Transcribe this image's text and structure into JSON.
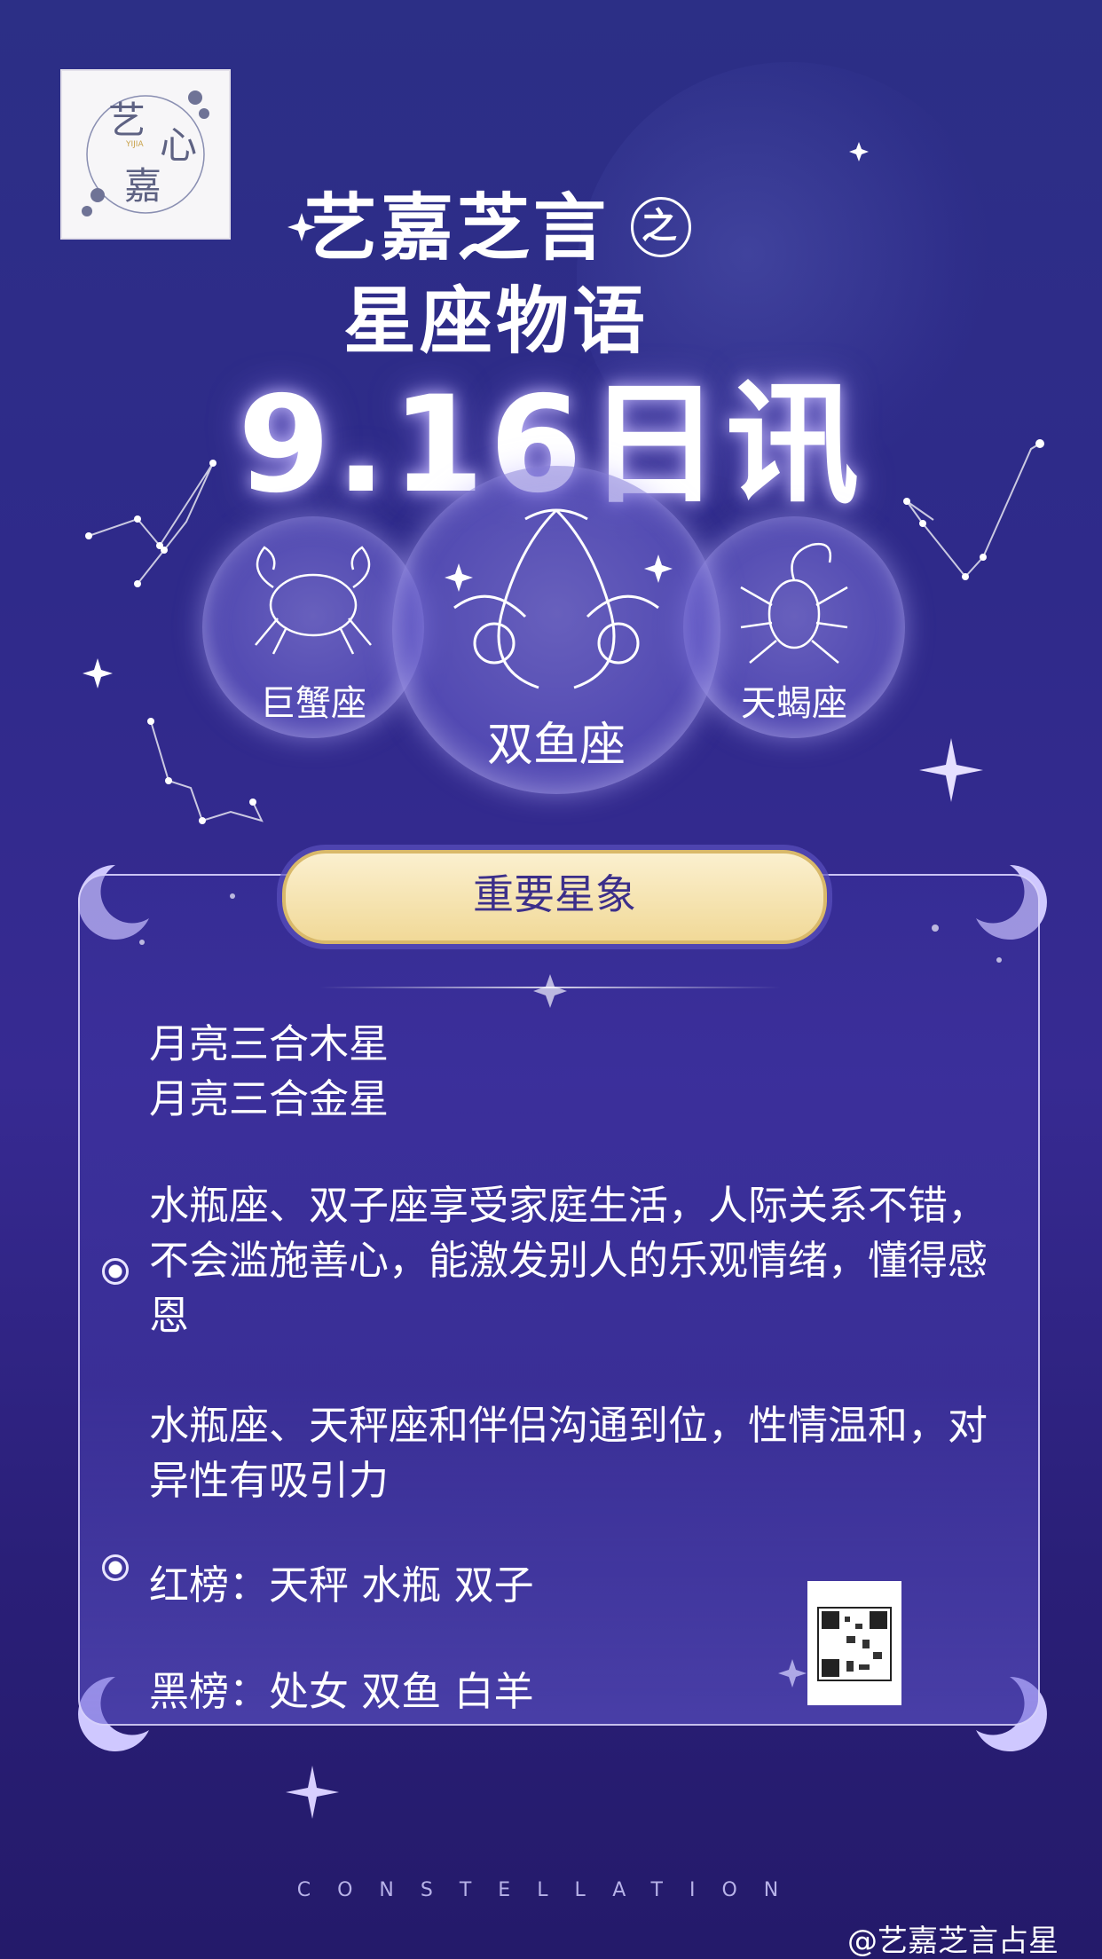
{
  "logo": {
    "chars": [
      "艺",
      "心",
      "嘉"
    ],
    "sub": "YIJIA"
  },
  "header": {
    "line1": "艺嘉芝言",
    "zhi": "之",
    "line2": "星座物语",
    "date": "9.16日讯"
  },
  "signs": {
    "left": "巨蟹座",
    "center": "双鱼座",
    "right": "天蝎座"
  },
  "panel": {
    "title": "重要星象",
    "aspects": [
      "月亮三合木星",
      "月亮三合金星"
    ],
    "para1": "水瓶座、双子座享受家庭生活，人际关系不错，不会滥施善心，能激发别人的乐观情绪，懂得感恩",
    "para2": "水瓶座、天秤座和伴侣沟通到位，性情温和，对异性有吸引力",
    "red": "红榜：天秤 水瓶 双子",
    "black": "黑榜：处女 双鱼 白羊"
  },
  "footer": {
    "word": "CONSTELLATION",
    "watermark": "@艺嘉芝言占星"
  },
  "colors": {
    "bg": "#2f2a8a",
    "pill": "#f6e4b0",
    "pill_text": "#3c2f8a"
  }
}
